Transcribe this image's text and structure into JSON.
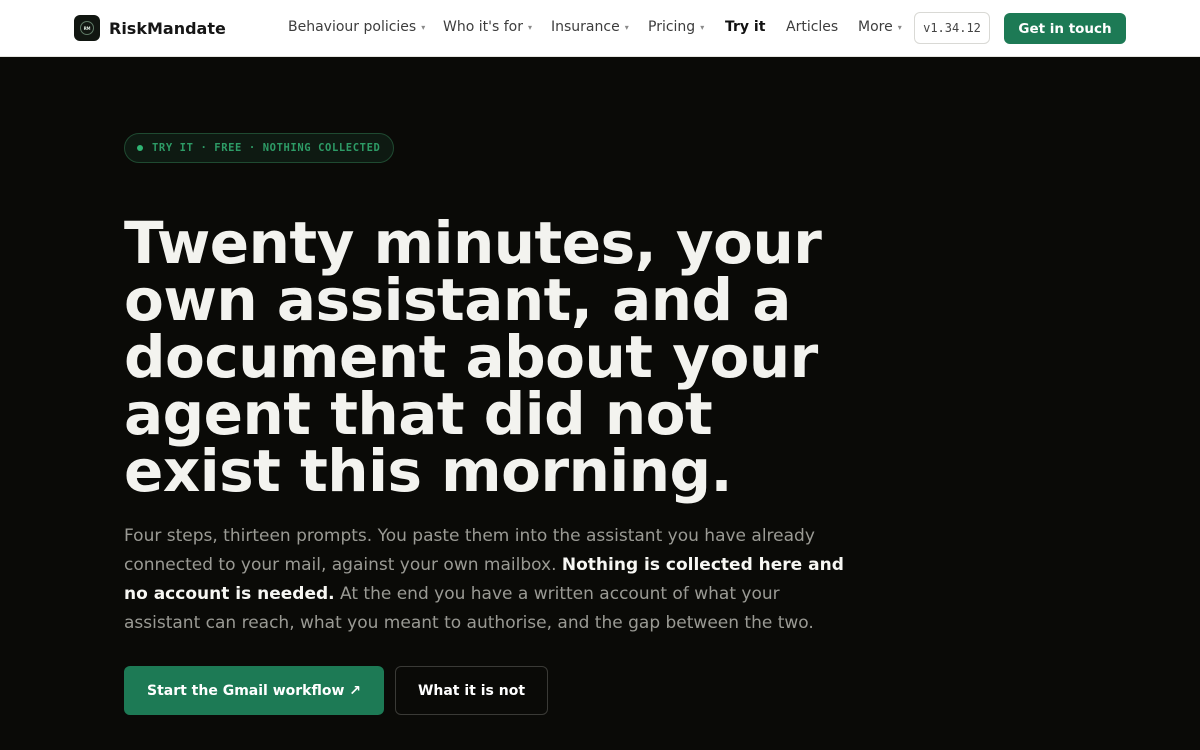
{
  "brand": {
    "name": "RiskMandate",
    "mark": "RM"
  },
  "nav": {
    "items": [
      {
        "label": "Behaviour policies",
        "caret": "▾"
      },
      {
        "label": "Who it's for",
        "caret": "▾"
      },
      {
        "label": "Insurance",
        "caret": "▾"
      },
      {
        "label": "Pricing",
        "caret": "▾"
      },
      {
        "label": "Try it"
      },
      {
        "label": "Articles"
      },
      {
        "label": "More",
        "caret": "▾"
      }
    ],
    "active": "Try it"
  },
  "version": "v1.34.12",
  "header_cta": "Get in touch",
  "hero": {
    "eyebrow": "TRY IT · FREE · NOTHING COLLECTED",
    "headline": "Twenty minutes, your own assistant, and a document about your agent that did not exist this morning.",
    "lede_before": "Four steps, thirteen prompts. You paste them into the assistant you have already connected to your mail, against your own mailbox. ",
    "lede_strong": "Nothing is collected here and no account is needed.",
    "lede_after": " At the end you have a written account of what your assistant can reach, what you meant to authorise, and the gap between the two.",
    "primary_cta": "Start the Gmail workflow ↗",
    "secondary_cta": "What it is not"
  },
  "colors": {
    "accent": "#1d7a55",
    "hero_bg": "#0a0a07",
    "eyebrow_text": "#2d9b66"
  }
}
